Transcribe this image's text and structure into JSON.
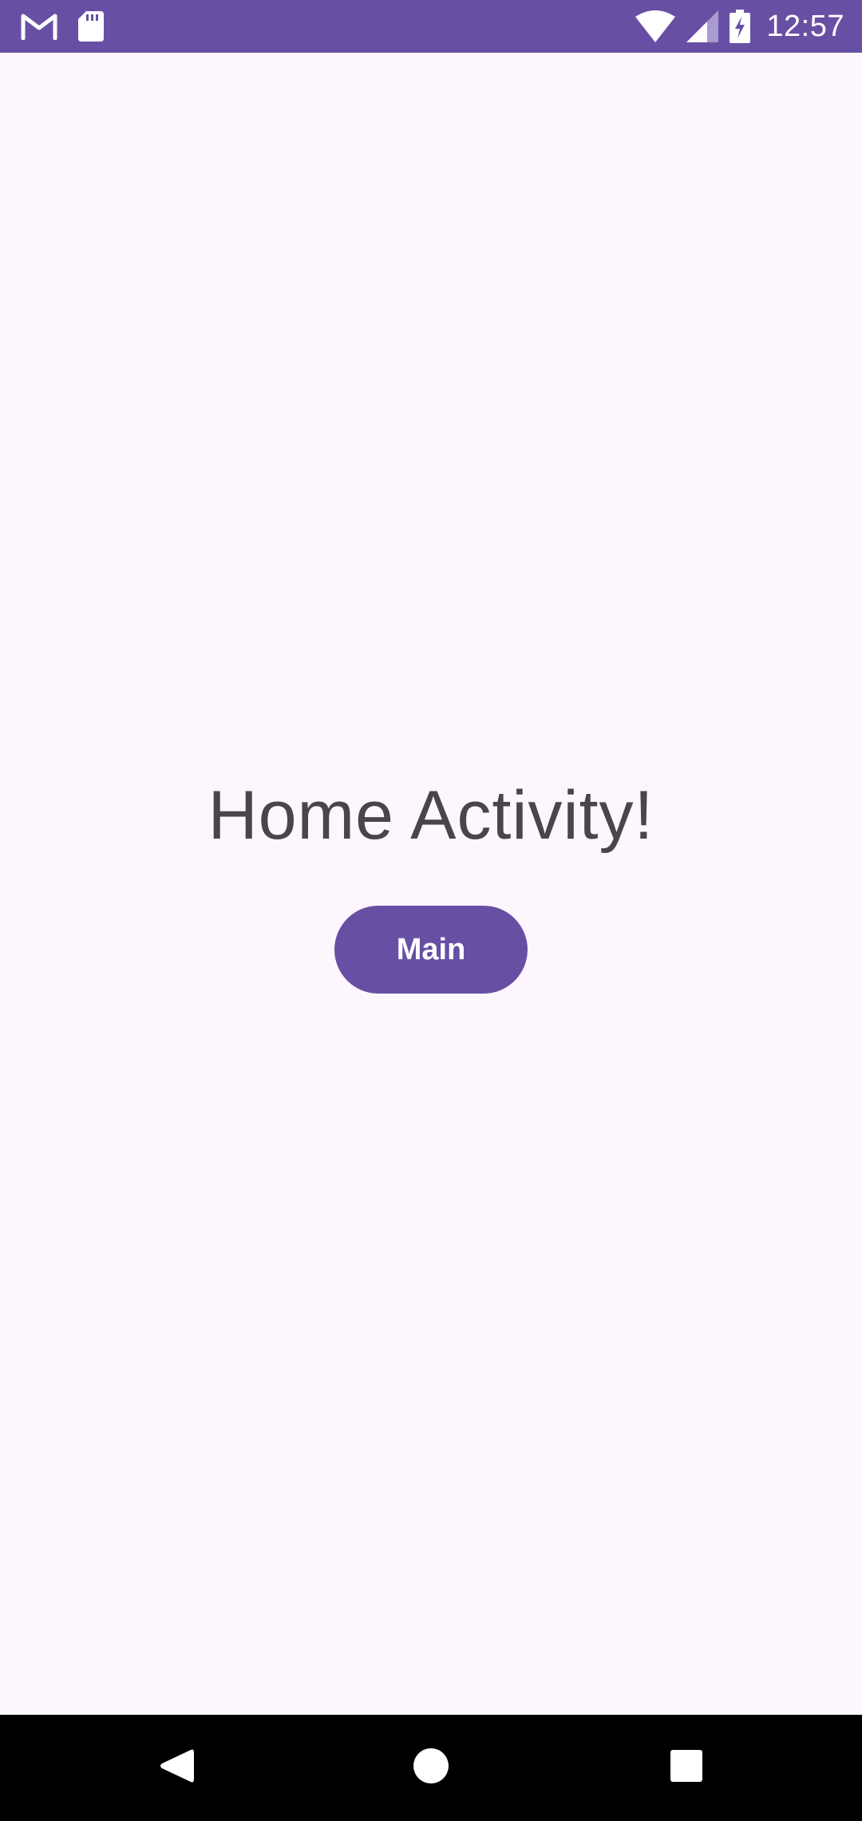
{
  "status_bar": {
    "time": "12:57",
    "left_icons": [
      "gmail-icon",
      "sd-card-icon"
    ],
    "right_icons": [
      "wifi-icon",
      "cell-signal-icon",
      "battery-charging-icon"
    ],
    "background": "#6750A4"
  },
  "main": {
    "title": "Home Activity!",
    "button_label": "Main",
    "background": "#FDF7FD",
    "accent": "#6750A4",
    "title_color": "#48454E"
  },
  "nav_bar": {
    "buttons": [
      "back-icon",
      "home-icon",
      "recents-icon"
    ]
  }
}
